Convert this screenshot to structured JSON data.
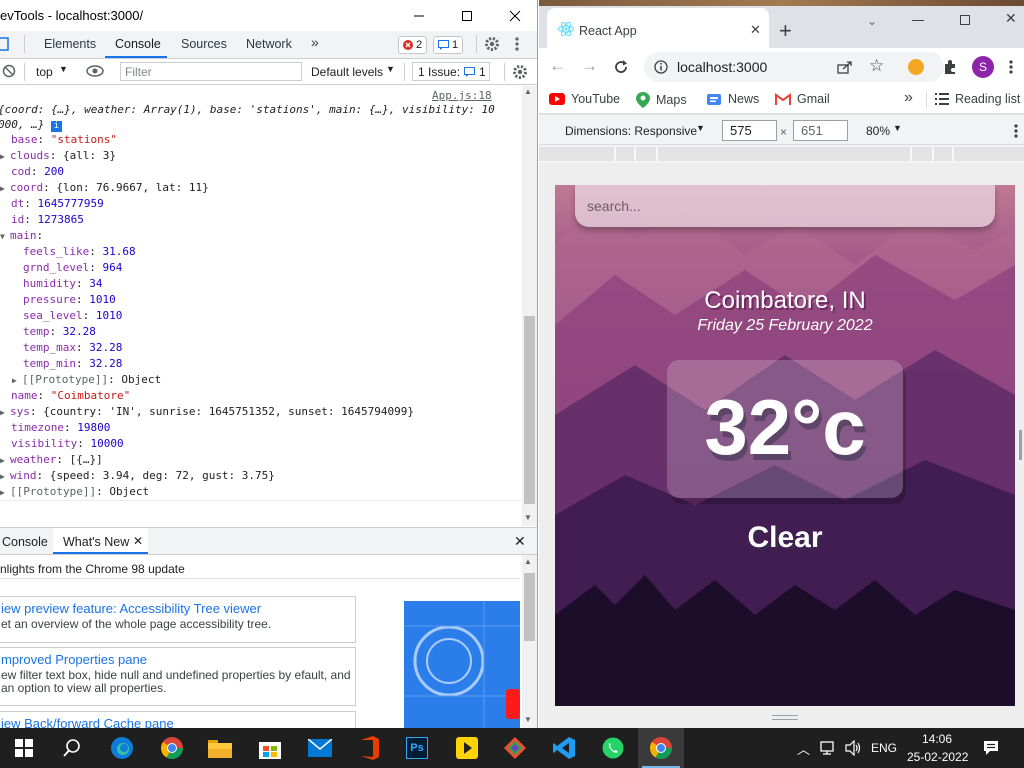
{
  "devtools": {
    "window_title": "evTools - localhost:3000/",
    "tabs": [
      "Elements",
      "Console",
      "Sources",
      "Network"
    ],
    "error_count": "2",
    "message_count": "1",
    "toolbar": {
      "context": "top",
      "filter_placeholder": "Filter",
      "levels": "Default levels",
      "issues": "1 Issue:",
      "issues_count": "1"
    },
    "source_link": "App.js:18",
    "summary_line1": "{coord: {…}, weather: Array(1), base: 'stations', main: {…}, visibility: 10",
    "summary_line2": "000, …}",
    "props": {
      "base": "\"stations\"",
      "clouds": "{all: 3}",
      "cod": "200",
      "coord": "{lon: 76.9667, lat: 11}",
      "dt": "1645777959",
      "id": "1273865",
      "feels_like": "31.68",
      "grnd_level": "964",
      "humidity": "34",
      "pressure": "1010",
      "sea_level": "1010",
      "temp": "32.28",
      "temp_max": "32.28",
      "temp_min": "32.28",
      "prototype_inner": "Object",
      "name": "\"Coimbatore\"",
      "sys": "{country: 'IN', sunrise: 1645751352, sunset: 1645794099}",
      "timezone": "19800",
      "visibility": "10000",
      "weather": "[{…}]",
      "wind": "{speed: 3.94, deg: 72, gust: 3.75}",
      "prototype_outer": "Object"
    },
    "drawer": {
      "tab_console": "Console",
      "tab_whatsnew": "What's New",
      "highlight": "nlights from the Chrome 98 update",
      "cards": [
        {
          "title": "iew preview feature: Accessibility Tree viewer",
          "desc": "et an overview of the whole page accessibility tree."
        },
        {
          "title": "mproved Properties pane",
          "desc": "ew filter text box, hide null and undefined properties by efault, and an option to view all properties."
        },
        {
          "title": "iew Back/forward Cache pane",
          "desc": ""
        }
      ]
    }
  },
  "chrome": {
    "tab_title": "React App",
    "url": "localhost:3000",
    "profile_initial": "S",
    "bookmarks": [
      "YouTube",
      "Maps",
      "News",
      "Gmail"
    ],
    "reading_list": "Reading list",
    "emulation": {
      "dimensions": "Dimensions: Responsive",
      "width": "575",
      "height": "651",
      "zoom": "80%",
      "times": "×"
    },
    "app": {
      "search_placeholder": "search...",
      "location": "Coimbatore, IN",
      "date": "Friday 25 February 2022",
      "temperature": "32°c",
      "weather": "Clear"
    }
  },
  "taskbar": {
    "language": "ENG",
    "time": "14:06",
    "date": "25-02-2022",
    "apps": [
      "windows-start",
      "search",
      "edge",
      "chrome",
      "file-explorer",
      "store",
      "mail",
      "office",
      "photoshop",
      "media-player",
      "git",
      "vscode",
      "whatsapp",
      "chrome-active"
    ]
  },
  "colors": {
    "accent": "#1a73e8",
    "app_gradient_top": "#c07a92",
    "app_gradient_bottom": "#1c0e2c",
    "taskbar": "#1f1f1f"
  }
}
